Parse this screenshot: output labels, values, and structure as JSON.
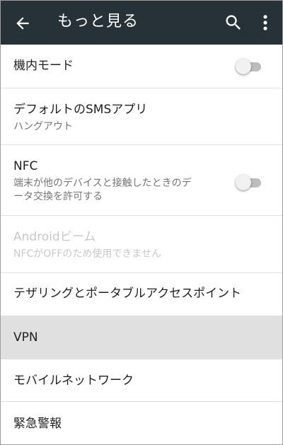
{
  "appbar": {
    "title": "もっと見る",
    "icons": [
      "back-arrow-icon",
      "search-icon",
      "more-vert-icon"
    ]
  },
  "items": [
    {
      "label": "機内モード",
      "has_toggle": true,
      "toggle_on": false
    },
    {
      "label": "デフォルトのSMSアプリ",
      "sub": "ハングアウト"
    },
    {
      "label": "NFC",
      "sub_lines": [
        "端末が他のデバイスと接触したときのデ",
        "ータ交換を許可する"
      ],
      "has_toggle": true,
      "toggle_on": false
    },
    {
      "label": "Androidビーム",
      "sub": "NFCがOFFのため使用できません",
      "disabled": true
    },
    {
      "label": "テザリングとポータブルアクセスポイント"
    },
    {
      "label": "VPN",
      "selected": true
    },
    {
      "label": "モバイルネットワーク"
    },
    {
      "label": "緊急警報"
    }
  ],
  "colors": {
    "appbar": "#263238",
    "selected_row": "#e0e0e0",
    "disabled_text": "#c8c8c8"
  }
}
